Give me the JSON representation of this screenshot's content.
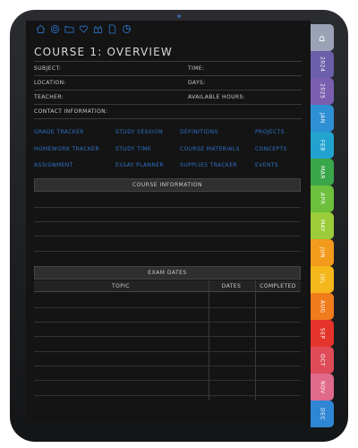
{
  "header": {
    "icons": [
      "home-icon",
      "target-icon",
      "folder-icon",
      "heart-icon",
      "gift-icon",
      "document-icon",
      "pie-chart-icon"
    ],
    "title": "COURSE 1: OVERVIEW"
  },
  "fields": {
    "subject": "SUBJECT:",
    "time": "TIME:",
    "location": "LOCATION:",
    "days": "DAYS:",
    "teacher": "TEACHER:",
    "available_hours": "AVAILABLE HOURS:",
    "contact": "CONTACT INFORMATION:"
  },
  "links": {
    "grade_tracker": "GRADE TRACKER",
    "study_session": "STUDY SESSION",
    "definitions": "DEFINITIONS",
    "projects": "PROJECTS",
    "homework_tracker": "HOMEWORK TRACKER",
    "study_time": "STUDY TIME",
    "course_materials": "COURSE MATERIALS",
    "concepts": "CONCEPTS",
    "assignment": "ASSIGNMENT",
    "essay_planner": "ESSAY PLANNER",
    "supplies_tracker": "SUPPLIES TRACKER",
    "events": "EVENTS"
  },
  "course_info": {
    "title": "COURSE INFORMATION"
  },
  "exam_dates": {
    "title": "EXAM DATES",
    "columns": {
      "topic": "TOPIC",
      "dates": "DATES",
      "completed": "COMPLETED"
    }
  },
  "tabs": {
    "home": {
      "icon": "home-icon",
      "glyph": "⌂",
      "color": "#9aa3b5"
    },
    "y2024": {
      "label": "2024",
      "color": "#6a5fa8"
    },
    "y2025": {
      "label": "2025",
      "color": "#7a5fb0"
    },
    "jan": {
      "label": "JAN",
      "color": "#2e8fd4"
    },
    "feb": {
      "label": "FEB",
      "color": "#22a3cf"
    },
    "mar": {
      "label": "MAR",
      "color": "#3aa64a"
    },
    "apr": {
      "label": "APR",
      "color": "#6cc03c"
    },
    "may": {
      "label": "MAY",
      "color": "#9ccc3a"
    },
    "jun": {
      "label": "JUN",
      "color": "#f29a1c"
    },
    "jul": {
      "label": "JUL",
      "color": "#f5b81c"
    },
    "aug": {
      "label": "AUG",
      "color": "#f07c1c"
    },
    "sep": {
      "label": "SEP",
      "color": "#e5342b"
    },
    "oct": {
      "label": "OCT",
      "color": "#e04b5a"
    },
    "nov": {
      "label": "NOV",
      "color": "#e06a8a"
    },
    "dec": {
      "label": "DEC",
      "color": "#2e86d4"
    }
  }
}
